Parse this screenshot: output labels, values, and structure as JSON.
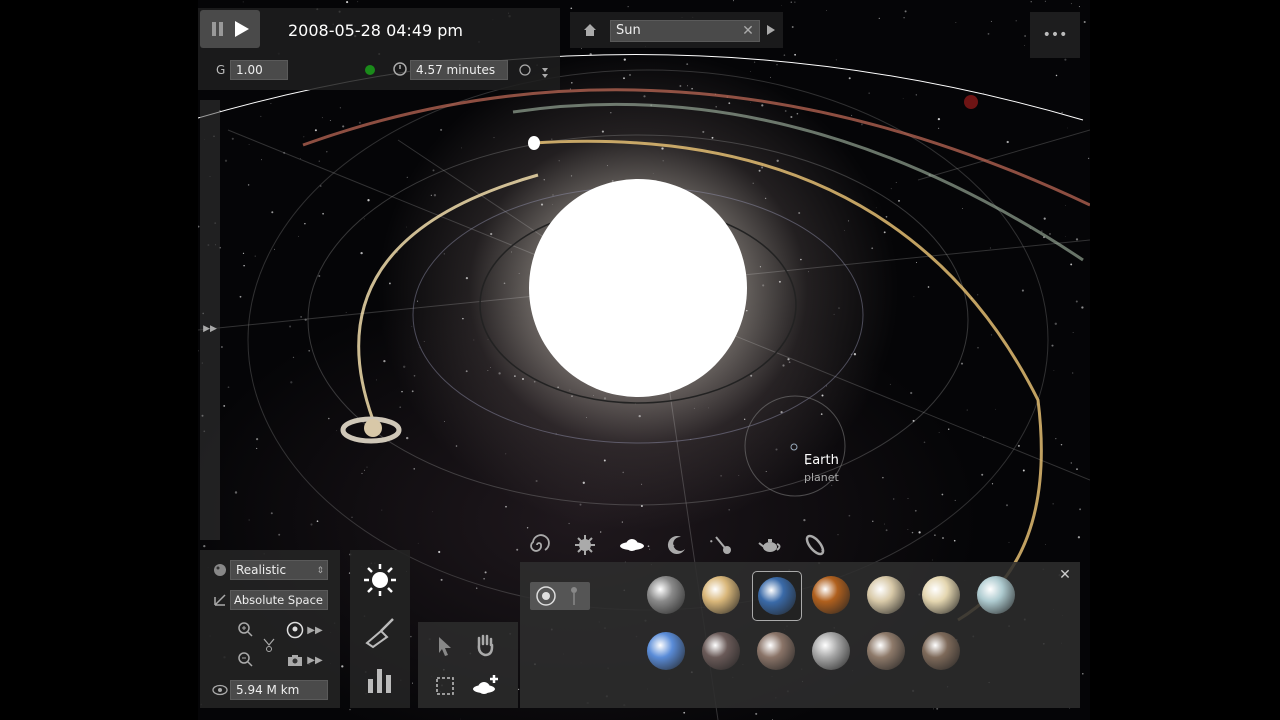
{
  "playback": {
    "state": "paused"
  },
  "header": {
    "datetime": "2008-05-28 04:49 pm"
  },
  "sim": {
    "g_label": "G",
    "g_value": "1.00",
    "timestep": "4.57 minutes"
  },
  "focus": {
    "object": "Sun"
  },
  "scene": {
    "label_name": "Earth",
    "label_type": "planet"
  },
  "view": {
    "visual_mode": "Realistic",
    "reference_frame": "Absolute Space",
    "distance": "5.94 M km"
  },
  "planet_palette": {
    "row1": [
      {
        "icon": "mercury",
        "color": "#8a8a8a"
      },
      {
        "icon": "venus",
        "color": "#d9b77a"
      },
      {
        "icon": "earth",
        "color": "#3a6aa8",
        "selected": true
      },
      {
        "icon": "mars",
        "color": "#b0601e"
      },
      {
        "icon": "jupiter",
        "color": "#d8c9a8"
      },
      {
        "icon": "saturn",
        "color": "#e4d6b0"
      },
      {
        "icon": "uranus",
        "color": "#aecbd0"
      }
    ],
    "row2": [
      {
        "icon": "neptune",
        "color": "#5a8cd8"
      },
      {
        "icon": "rocky-1",
        "color": "#6a5a58"
      },
      {
        "icon": "rocky-2",
        "color": "#8a7468"
      },
      {
        "icon": "rocky-3",
        "color": "#a8a8a8"
      },
      {
        "icon": "rocky-4",
        "color": "#8e7a6a"
      },
      {
        "icon": "rocky-5",
        "color": "#7e6a5a"
      }
    ]
  },
  "colors": {
    "accent_green": "#1a8a1a",
    "panel": "#2a2a2a"
  }
}
